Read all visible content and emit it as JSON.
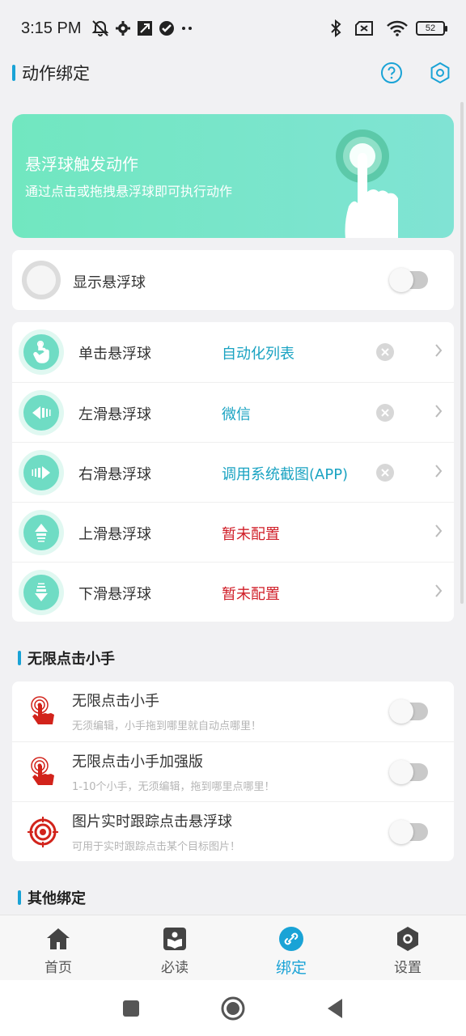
{
  "status_bar": {
    "time": "3:15 PM",
    "battery": "52",
    "icons": [
      "mute-icon",
      "settings-icon",
      "nfc-icon",
      "check-icon",
      "more-icon",
      "bluetooth-icon",
      "sim-icon",
      "wifi-icon"
    ]
  },
  "header": {
    "title": "动作绑定",
    "icons": [
      "help-icon",
      "settings-hex-icon"
    ]
  },
  "banner": {
    "title": "悬浮球触发动作",
    "subtitle": "通过点击或拖拽悬浮球即可执行动作"
  },
  "show_ball": {
    "label": "显示悬浮球",
    "enabled": false
  },
  "gestures": [
    {
      "label": "单击悬浮球",
      "value": "自动化列表",
      "configured": true,
      "icon": "tap-icon"
    },
    {
      "label": "左滑悬浮球",
      "value": "微信",
      "configured": true,
      "icon": "swipe-left-icon"
    },
    {
      "label": "右滑悬浮球",
      "value": "调用系统截图(APP)",
      "configured": true,
      "icon": "swipe-right-icon"
    },
    {
      "label": "上滑悬浮球",
      "value": "暂未配置",
      "configured": false,
      "icon": "swipe-up-icon"
    },
    {
      "label": "下滑悬浮球",
      "value": "暂未配置",
      "configured": false,
      "icon": "swipe-down-icon"
    }
  ],
  "section_hands": {
    "title": "无限点击小手",
    "items": [
      {
        "title": "无限点击小手",
        "subtitle": "无须编辑，小手拖到哪里就自动点哪里！",
        "enabled": false,
        "icon": "click-hand-icon"
      },
      {
        "title": "无限点击小手加强版",
        "subtitle": "1-10个小手，无须编辑，拖到哪里点哪里！",
        "enabled": false,
        "icon": "click-hand-plus-icon"
      },
      {
        "title": "图片实时跟踪点击悬浮球",
        "subtitle": "可用于实时跟踪点击某个目标图片！",
        "enabled": false,
        "icon": "target-icon"
      }
    ]
  },
  "section_other": {
    "title": "其他绑定"
  },
  "bottom_nav": [
    {
      "label": "首页",
      "icon": "home-icon",
      "active": false
    },
    {
      "label": "必读",
      "icon": "book-icon",
      "active": false
    },
    {
      "label": "绑定",
      "icon": "link-icon",
      "active": true
    },
    {
      "label": "设置",
      "icon": "settings-icon",
      "active": false
    }
  ],
  "colors": {
    "accent": "#1aa3d6",
    "banner_start": "#71e7c0",
    "banner_end": "#80e3d4",
    "configured_value": "#1aa3c2",
    "unconfigured_value": "#d0202a"
  }
}
